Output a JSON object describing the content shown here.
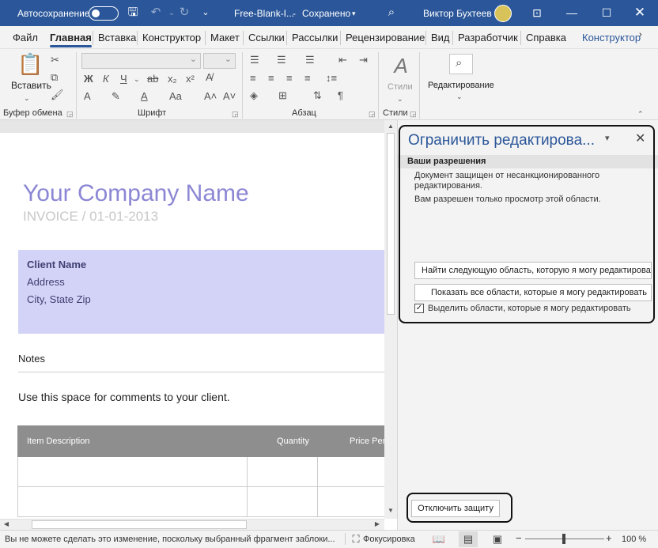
{
  "titlebar": {
    "autosave_label": "Автосохранение",
    "doc_title": "Free-Blank-I...",
    "save_status": "Сохранено",
    "user_name": "Виктор Бухтеев",
    "accent": "#2b579a"
  },
  "menu_tabs": [
    "Файл",
    "Главная",
    "Вставка",
    "Конструктор",
    "Макет",
    "Ссылки",
    "Рассылки",
    "Рецензирование",
    "Вид",
    "Разработчик",
    "Справка",
    "Конструктор"
  ],
  "ribbon": {
    "groups": {
      "clipboard": "Буфер обмена",
      "font": "Шрифт",
      "paragraph": "Абзац",
      "styles": "Стили",
      "editing": "Редактирование"
    },
    "paste_label": "Вставить",
    "styles_label": "Стили",
    "editing_label": "Редактирование",
    "font_buttons": [
      "Ж",
      "К",
      "Ч",
      "ab",
      "x₂",
      "x²"
    ]
  },
  "document": {
    "company": "Your Company Name",
    "invoice_prefix": "INVOICE",
    "invoice_sep": "/",
    "invoice_date": "01-01-2013",
    "client_name": "Client Name",
    "address": "Address",
    "city": "City, State Zip",
    "notes_heading": "Notes",
    "notes_body": "Use this space for comments to your client.",
    "table_headers": [
      "Item Description",
      "Quantity",
      "Price Per"
    ],
    "brand_color": "#8b87d4",
    "client_bg": "#d3d3f7"
  },
  "pane": {
    "title": "Ограничить редактирова...",
    "section": "Ваши разрешения",
    "protected_line1": "Документ защищен от несанкционированного",
    "protected_line2": "редактирования.",
    "view_only": "Вам разрешен только просмотр этой области.",
    "find_next": "Найти следующую область, которую я могу редактировать",
    "show_all": "Показать все области, которые я могу редактировать",
    "highlight": "Выделить области, которые я могу редактировать",
    "highlight_checked": true,
    "stop_protection": "Отключить защиту"
  },
  "statusbar": {
    "message": "Вы не можете сделать это изменение, поскольку выбранный фрагмент заблоки...",
    "focus": "Фокусировка",
    "zoom": "100 %"
  }
}
